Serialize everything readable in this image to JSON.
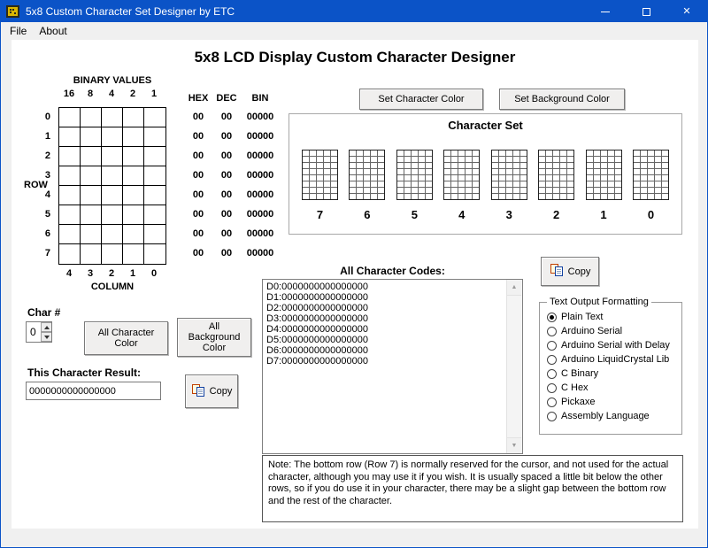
{
  "window": {
    "title": "5x8 Custom Character Set Designer by ETC"
  },
  "colors": {
    "titlebar_blue": "#0b53c7",
    "form_background": "#ffffff",
    "chrome_gray": "#f0f0f0"
  },
  "menu": {
    "items": [
      {
        "label": "File"
      },
      {
        "label": "About"
      }
    ]
  },
  "main": {
    "heading": "5x8 LCD Display Custom Character Designer",
    "designer": {
      "binary_values_label": "BINARY VALUES",
      "bit_labels": [
        "16",
        "8",
        "4",
        "2",
        "1"
      ],
      "row_label": "ROW",
      "row_numbers": [
        "0",
        "1",
        "2",
        "3",
        "4",
        "5",
        "6",
        "7"
      ],
      "column_label": "COLUMN",
      "column_numbers": [
        "4",
        "3",
        "2",
        "1",
        "0"
      ]
    },
    "codes_table": {
      "headers": {
        "hex": "HEX",
        "dec": "DEC",
        "bin": "BIN"
      },
      "rows": [
        {
          "hex": "00",
          "dec": "00",
          "bin": "00000"
        },
        {
          "hex": "00",
          "dec": "00",
          "bin": "00000"
        },
        {
          "hex": "00",
          "dec": "00",
          "bin": "00000"
        },
        {
          "hex": "00",
          "dec": "00",
          "bin": "00000"
        },
        {
          "hex": "00",
          "dec": "00",
          "bin": "00000"
        },
        {
          "hex": "00",
          "dec": "00",
          "bin": "00000"
        },
        {
          "hex": "00",
          "dec": "00",
          "bin": "00000"
        },
        {
          "hex": "00",
          "dec": "00",
          "bin": "00000"
        }
      ]
    },
    "color_buttons": {
      "set_character_color": "Set Character Color",
      "set_background_color": "Set Background Color",
      "all_character_color": "All Character Color",
      "all_background_color": "All Background Color"
    },
    "character_set": {
      "title": "Character Set",
      "slot_labels": [
        "7",
        "6",
        "5",
        "4",
        "3",
        "2",
        "1",
        "0"
      ]
    },
    "all_codes": {
      "label": "All Character Codes:",
      "lines": [
        "D0:0000000000000000",
        "D1:0000000000000000",
        "D2:0000000000000000",
        "D3:0000000000000000",
        "D4:0000000000000000",
        "D5:0000000000000000",
        "D6:0000000000000000",
        "D7:0000000000000000"
      ]
    },
    "copy_button_label": "Copy",
    "formatting": {
      "title": "Text Output Formatting",
      "options": [
        {
          "label": "Plain Text",
          "selected": true
        },
        {
          "label": "Arduino Serial",
          "selected": false
        },
        {
          "label": "Arduino Serial with Delay",
          "selected": false
        },
        {
          "label": "Arduino LiquidCrystal Lib",
          "selected": false
        },
        {
          "label": "C Binary",
          "selected": false
        },
        {
          "label": "C Hex",
          "selected": false
        },
        {
          "label": "Pickaxe",
          "selected": false
        },
        {
          "label": "Assembly Language",
          "selected": false
        }
      ]
    },
    "char_number": {
      "label": "Char #",
      "value": "0"
    },
    "result": {
      "label": "This Character Result:",
      "value": "0000000000000000"
    },
    "note": "Note: The bottom row (Row 7) is normally reserved for the cursor, and not used for the actual character, although you may use it if you wish. It is usually spaced a little bit below the other rows, so if you do use it in your character, there may be a slight gap between the bottom row and the rest of the character."
  }
}
